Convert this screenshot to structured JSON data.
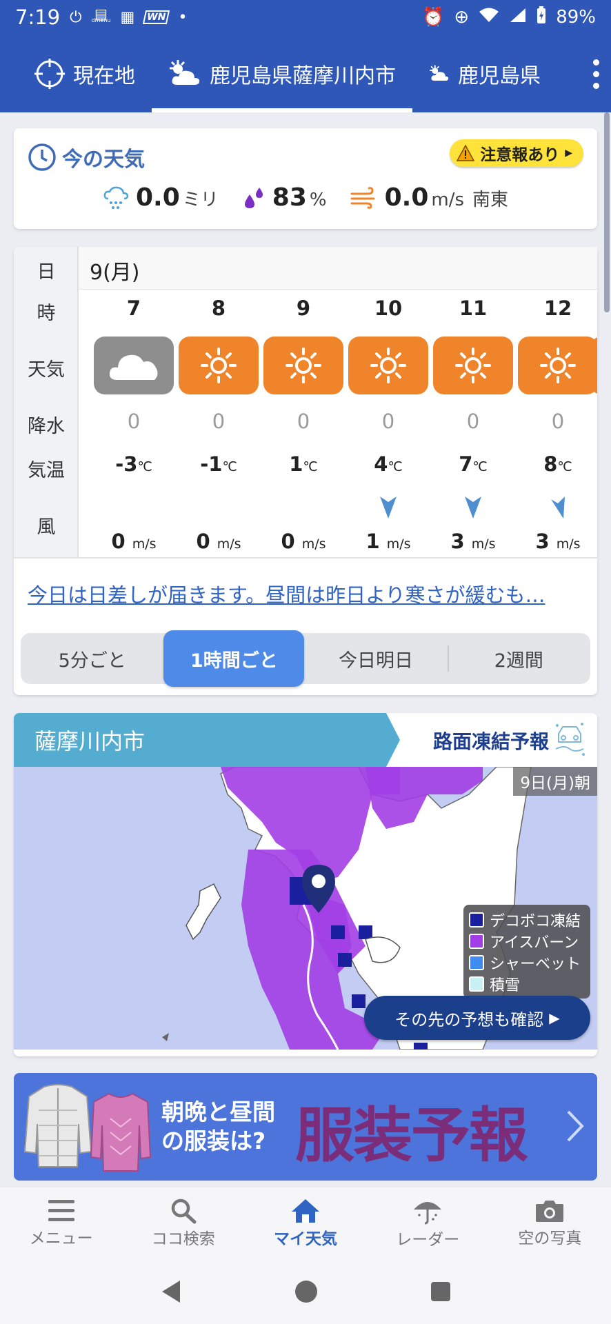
{
  "status_bar": {
    "time": "7:19",
    "battery": "89%",
    "notif_text": "dmenu"
  },
  "location_tabs": [
    {
      "label": "現在地"
    },
    {
      "label": "鹿児島県薩摩川内市"
    },
    {
      "label": "鹿児島県"
    }
  ],
  "current_weather": {
    "title": "今の天気",
    "warning": "注意報あり",
    "precip_value": "0.0",
    "precip_unit": "ミリ",
    "humidity_value": "83",
    "humidity_unit": "%",
    "wind_value": "0.0",
    "wind_unit": "m/s",
    "wind_dir": "南東"
  },
  "hourly": {
    "labels": {
      "day": "日",
      "hour": "時",
      "weather": "天気",
      "precip": "降水",
      "temp": "気温",
      "wind": "風"
    },
    "day": "9(月)",
    "temp_unit": "℃",
    "wind_unit": "m/s",
    "hours": [
      {
        "hour": "7",
        "weather": "cloudy",
        "precip": "0",
        "temp": "-3",
        "wind": "0",
        "wind_dir": "none"
      },
      {
        "hour": "8",
        "weather": "sunny",
        "precip": "0",
        "temp": "-1",
        "wind": "0",
        "wind_dir": "none"
      },
      {
        "hour": "9",
        "weather": "sunny",
        "precip": "0",
        "temp": "1",
        "wind": "0",
        "wind_dir": "none"
      },
      {
        "hour": "10",
        "weather": "sunny",
        "precip": "0",
        "temp": "4",
        "wind": "1",
        "wind_dir": "south"
      },
      {
        "hour": "11",
        "weather": "sunny",
        "precip": "0",
        "temp": "7",
        "wind": "3",
        "wind_dir": "south"
      },
      {
        "hour": "12",
        "weather": "sunny",
        "precip": "0",
        "temp": "8",
        "wind": "3",
        "wind_dir": "southeast"
      }
    ],
    "forecast_text": "今日は日差しが届きます。昼間は昨日より寒さが緩むも…",
    "segments": [
      "5分ごと",
      "1時間ごと",
      "今日明日",
      "2週間"
    ],
    "selected_segment": "1時間ごと"
  },
  "road_map": {
    "city": "薩摩川内市",
    "link": "路面凍結予報",
    "date_tag": "9日(月)朝",
    "legend": [
      {
        "label": "デコボコ凍結",
        "color": "#1a1f9e"
      },
      {
        "label": "アイスバーン",
        "color": "#a23ee6"
      },
      {
        "label": "シャーベット",
        "color": "#3f8cf0"
      },
      {
        "label": "積雪",
        "color": "#c9f1f3"
      }
    ],
    "button": "その先の予想も確認"
  },
  "banner": {
    "line1": "朝晩と昼間",
    "line2": "の服装は?",
    "big": "服装予報"
  },
  "bottom_nav": [
    {
      "label": "メニュー",
      "icon": "menu-icon"
    },
    {
      "label": "ココ検索",
      "icon": "search-icon"
    },
    {
      "label": "マイ天気",
      "icon": "home-icon"
    },
    {
      "label": "レーダー",
      "icon": "radar-umbrella-icon"
    },
    {
      "label": "空の写真",
      "icon": "camera-icon"
    }
  ],
  "colors": {
    "header": "#2e57b8",
    "sun": "#f0842b",
    "cloud": "#8e8e8e",
    "accent": "#4e8be8",
    "link": "#2f63c4"
  }
}
